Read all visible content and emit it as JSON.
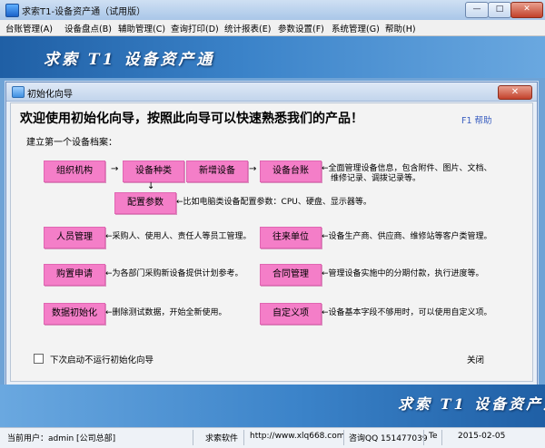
{
  "window": {
    "title": "求索T1-设备资产通（试用版）",
    "minimize": "—",
    "maximize": "□",
    "close": "✕"
  },
  "menu": [
    "台账管理(A)",
    "设备盘点(B)",
    "辅助管理(C)",
    "查询打印(D)",
    "统计报表(E)",
    "参数设置(F)",
    "系统管理(G)",
    "帮助(H)"
  ],
  "banner": {
    "logo": "求索 T1 设备资产通"
  },
  "dialog": {
    "title": "初始化向导",
    "close": "✕",
    "welcome": "欢迎使用初始化向导，按照此向导可以快速熟悉我们的产品！",
    "help": "F1 帮助",
    "subtitle": "建立第一个设备档案：",
    "boxes": {
      "org": "组织机构",
      "category": "设备种类",
      "add_device": "新增设备",
      "ledger": "设备台账",
      "config_params": "配置参数",
      "personnel": "人员管理",
      "contacts": "往来单位",
      "purchase": "购置申请",
      "contract": "合同管理",
      "data_init": "数据初始化",
      "custom": "自定义项"
    },
    "desc": {
      "ledger_1": "←全面管理设备信息，包含附件、图片、文档、",
      "ledger_2": "维修记录、调拨记录等。",
      "config": "←比如电脑类设备配置参数：CPU、硬盘、显示器等。",
      "personnel": "←采购人、使用人、责任人等员工管理。",
      "contacts": "←设备生产商、供应商、维修站等客户类管理。",
      "purchase": "←为各部门采购新设备提供计划参考。",
      "contract": "←管理设备实施中的分期付款，执行进度等。",
      "data_init": "←删除测试数据，开始全新使用。",
      "custom": "←设备基本字段不够用时，可以使用自定义项。"
    },
    "arrows": {
      "right": "→",
      "down": "↓"
    },
    "checkbox_label": "下次启动不运行初始化向导",
    "close_button": "关闭"
  },
  "footer": {
    "logo": "求索 T1 设备资产通"
  },
  "status": {
    "user": "当前用户：admin [公司总部]",
    "company": "求索软件",
    "website": "http://www.xlq668.com",
    "qq": "咨询QQ 151477039",
    "te": "Te",
    "date": "2015-02-05"
  }
}
